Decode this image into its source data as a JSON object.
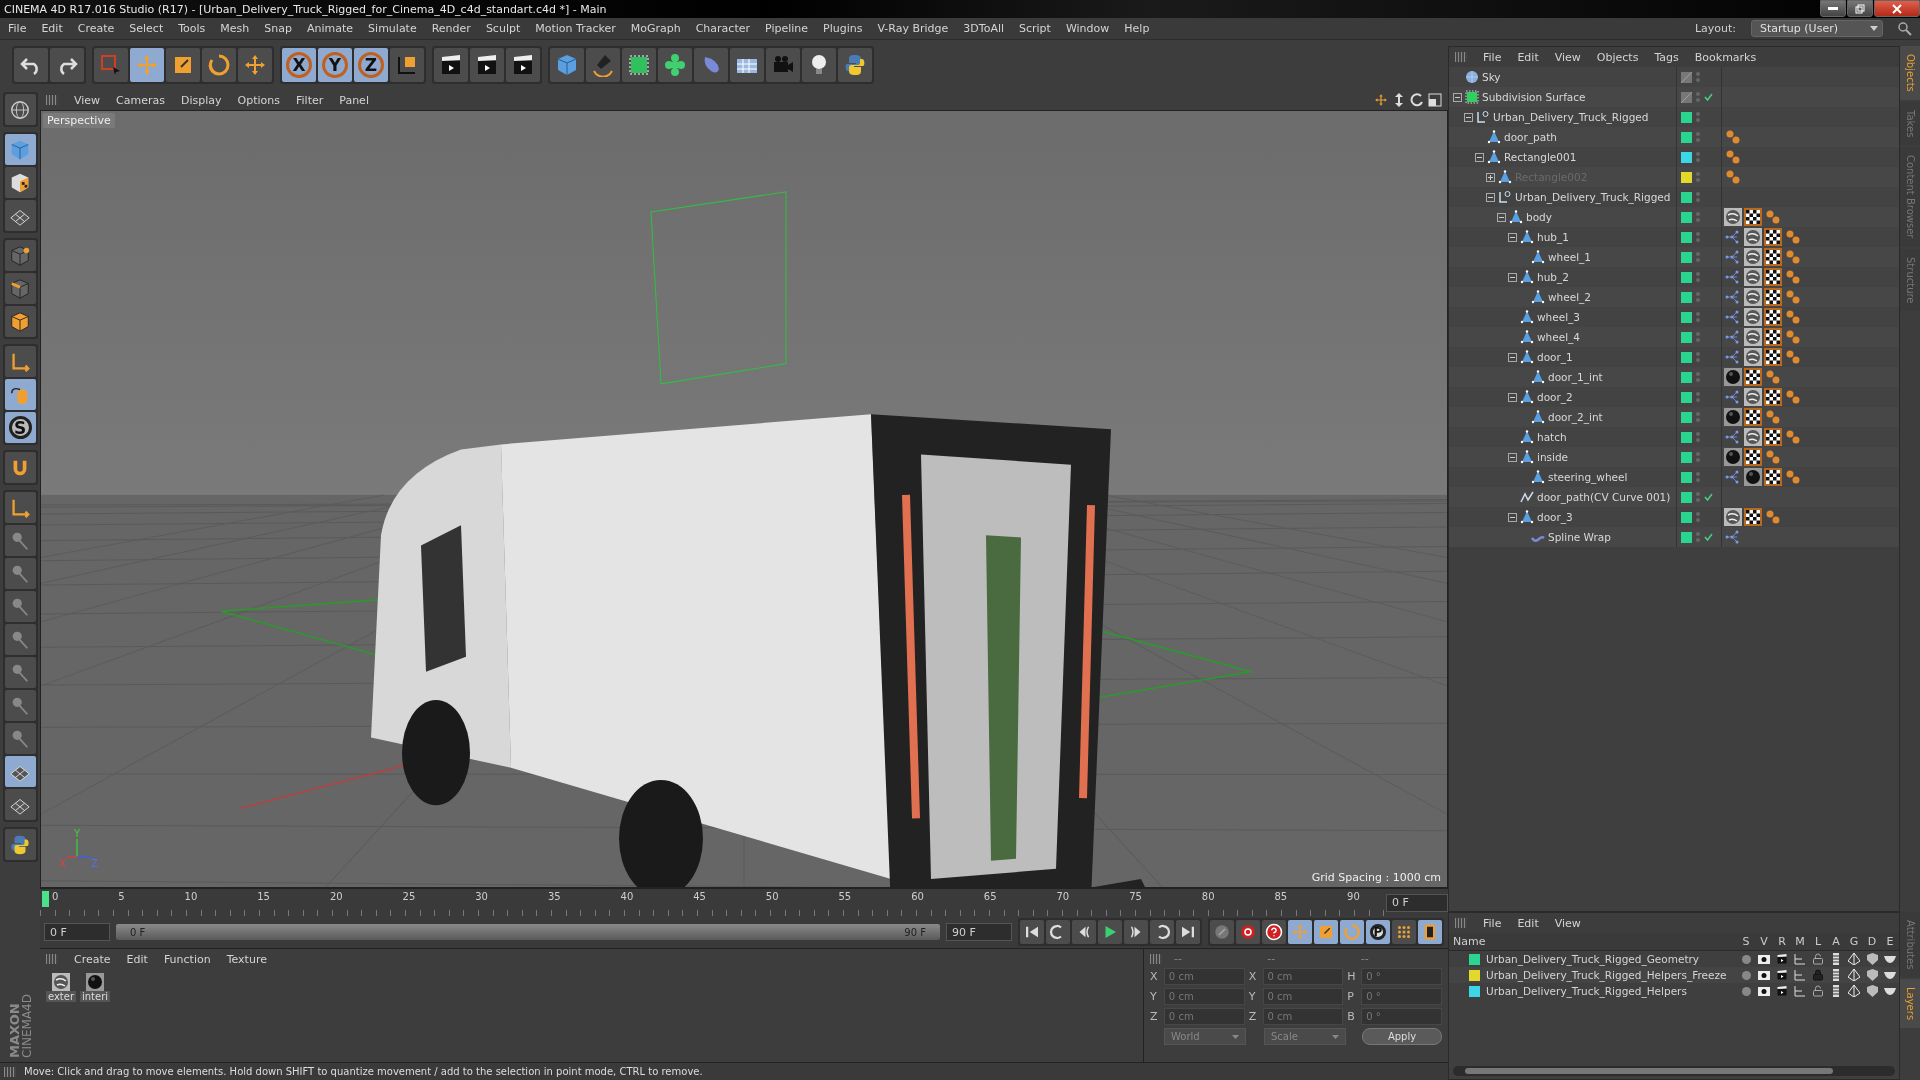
{
  "window": {
    "title": "CINEMA 4D R17.016 Studio (R17) - [Urban_Delivery_Truck_Rigged_for_Cinema_4D_c4d_standart.c4d *] - Main"
  },
  "menu": [
    "File",
    "Edit",
    "Create",
    "Select",
    "Tools",
    "Mesh",
    "Snap",
    "Animate",
    "Simulate",
    "Render",
    "Sculpt",
    "Motion Tracker",
    "MoGraph",
    "Character",
    "Pipeline",
    "Plugins",
    "V-Ray Bridge",
    "3DToAll",
    "Script",
    "Window",
    "Help"
  ],
  "layout": {
    "label": "Layout:",
    "value": "Startup (User)"
  },
  "toolbar": [
    [
      {
        "kind": "undo",
        "selected": false
      },
      {
        "kind": "redo",
        "selected": false
      }
    ],
    [
      {
        "kind": "select",
        "selected": false
      },
      {
        "kind": "move",
        "selected": true
      },
      {
        "kind": "scale",
        "selected": false
      },
      {
        "kind": "rotate",
        "selected": false
      },
      {
        "kind": "move",
        "selected": false
      }
    ],
    [
      {
        "kind": "axis",
        "label": "X",
        "selected": true
      },
      {
        "kind": "axis",
        "label": "Y",
        "selected": true
      },
      {
        "kind": "axis",
        "label": "Z",
        "selected": true
      },
      {
        "kind": "coordinates",
        "selected": false
      }
    ],
    [
      {
        "kind": "clapper",
        "selected": false
      },
      {
        "kind": "clapper",
        "selected": false
      },
      {
        "kind": "clapper",
        "selected": false
      }
    ],
    [
      {
        "kind": "cube",
        "selected": false
      },
      {
        "kind": "pen",
        "selected": false
      },
      {
        "kind": "subdivision",
        "selected": false
      },
      {
        "kind": "cloner",
        "selected": false
      },
      {
        "kind": "deformer",
        "selected": false
      },
      {
        "kind": "floor",
        "selected": false
      },
      {
        "kind": "camera",
        "selected": false
      },
      {
        "kind": "bulb",
        "selected": false
      },
      {
        "kind": "python",
        "selected": false
      }
    ]
  ],
  "left_tools": [
    [
      {
        "kind": "globe",
        "selected": false
      }
    ],
    [
      {
        "kind": "cube",
        "selected": true
      },
      {
        "kind": "checker-cube",
        "selected": false
      },
      {
        "kind": "grid",
        "selected": false
      }
    ],
    [
      {
        "kind": "cube-point",
        "selected": false
      },
      {
        "kind": "cube-edge",
        "selected": false
      },
      {
        "kind": "cube-face",
        "selected": false
      }
    ],
    [
      {
        "kind": "axis-corner",
        "selected": false
      },
      {
        "kind": "mouse",
        "selected": true
      },
      {
        "kind": "snap",
        "label": "S",
        "selected": true
      }
    ],
    [
      {
        "kind": "magnet",
        "selected": false
      }
    ],
    [
      {
        "kind": "axis-corner",
        "selected": false
      },
      {
        "kind": "pin",
        "selected": false
      },
      {
        "kind": "pin",
        "selected": false
      },
      {
        "kind": "pin",
        "selected": false
      },
      {
        "kind": "pin",
        "selected": false
      },
      {
        "kind": "pin",
        "selected": false
      },
      {
        "kind": "pin",
        "selected": false
      },
      {
        "kind": "pin",
        "selected": false
      },
      {
        "kind": "grid",
        "selected": true
      },
      {
        "kind": "grid",
        "selected": false
      }
    ],
    [
      {
        "kind": "python",
        "selected": false
      }
    ]
  ],
  "logo": [
    "MAXON",
    "CINEMA4D"
  ],
  "viewport": {
    "menu": [
      "View",
      "Cameras",
      "Display",
      "Options",
      "Filter",
      "Panel"
    ],
    "camera": "Perspective",
    "grid_spacing": "Grid Spacing : 1000 cm",
    "axes": [
      "Y",
      "X",
      "Z"
    ]
  },
  "timeline": {
    "ticks": [
      "0",
      "5",
      "10",
      "15",
      "20",
      "25",
      "30",
      "35",
      "40",
      "45",
      "50",
      "55",
      "60",
      "65",
      "70",
      "75",
      "80",
      "85",
      "90"
    ],
    "current": "0 F",
    "start": "0 F",
    "range_start": "0 F",
    "range_end": "90 F",
    "level": 1,
    "end": "90 F"
  },
  "playback": [
    {
      "kind": "first",
      "selected": false
    },
    {
      "kind": "loop-back",
      "selected": false
    },
    {
      "kind": "prev",
      "selected": false
    },
    {
      "kind": "play",
      "selected": false
    },
    {
      "kind": "next",
      "selected": false
    },
    {
      "kind": "loop",
      "selected": false
    },
    {
      "kind": "last",
      "selected": false
    }
  ],
  "keying": [
    {
      "kind": "key-off",
      "selected": false
    },
    {
      "kind": "record",
      "selected": false
    },
    {
      "kind": "help",
      "selected": false
    },
    {
      "kind": "move",
      "selected": true
    },
    {
      "kind": "scale",
      "selected": true
    },
    {
      "kind": "rotate",
      "selected": true
    },
    {
      "kind": "param",
      "label": "P",
      "selected": true
    },
    {
      "kind": "dots",
      "selected": false
    },
    {
      "kind": "film",
      "selected": true
    }
  ],
  "materials": {
    "menu": [
      "Create",
      "Edit",
      "Function",
      "Texture"
    ],
    "items": [
      {
        "name": "exter",
        "kind": "light"
      },
      {
        "name": "interi",
        "kind": "dark"
      }
    ]
  },
  "coordinates": {
    "headers": [
      "--",
      "--",
      "--"
    ],
    "rows": [
      {
        "labels": [
          "X",
          "X",
          "H"
        ],
        "values": [
          "0 cm",
          "0 cm",
          "0 °"
        ]
      },
      {
        "labels": [
          "Y",
          "Y",
          "P"
        ],
        "values": [
          "0 cm",
          "0 cm",
          "0 °"
        ]
      },
      {
        "labels": [
          "Z",
          "Z",
          "B"
        ],
        "values": [
          "0 cm",
          "0 cm",
          "0 °"
        ]
      }
    ],
    "mode": "World",
    "size_mode": "Scale",
    "apply": "Apply"
  },
  "status": "Move: Click and drag to move elements. Hold down SHIFT to quantize movement / add to the selection in point mode, CTRL to remove.",
  "objects": {
    "menu": [
      "File",
      "Edit",
      "View",
      "Objects",
      "Tags",
      "Bookmarks"
    ],
    "tree": [
      {
        "name": "Sky",
        "kind": "sky",
        "checked": false,
        "disabled": false
      },
      {
        "name": "Subdivision Surface",
        "kind": "subdivision",
        "checked": true,
        "disabled": false,
        "expanded": true,
        "children": [
          {
            "name": "Urban_Delivery_Truck_Rigged",
            "kind": "null",
            "color": "#2bd58f",
            "checked": false,
            "disabled": false,
            "expanded": true,
            "children": [
              {
                "name": "door_path",
                "kind": "poly",
                "color": "#2bd58f",
                "checked": false,
                "disabled": false,
                "tags": [
                  {
                    "kind": "keys"
                  }
                ]
              },
              {
                "name": "Rectangle001",
                "kind": "poly",
                "color": "#3dd6e6",
                "checked": false,
                "disabled": false,
                "expanded": true,
                "tags": [
                  {
                    "kind": "keys"
                  }
                ],
                "children": [
                  {
                    "name": "Rectangle002",
                    "kind": "poly",
                    "color": "#e3d82c",
                    "checked": false,
                    "disabled": true,
                    "expanded": false,
                    "tags": [
                      {
                        "kind": "keys"
                      }
                    ]
                  },
                  {
                    "name": "Urban_Delivery_Truck_Rigged",
                    "kind": "null",
                    "color": "#2bd58f",
                    "checked": false,
                    "disabled": false,
                    "expanded": true,
                    "children": [
                      {
                        "name": "body",
                        "kind": "poly",
                        "color": "#2bd58f",
                        "checked": false,
                        "disabled": false,
                        "expanded": true,
                        "tags": [
                          {
                            "kind": "tex"
                          },
                          {
                            "kind": "checker"
                          },
                          {
                            "kind": "keys"
                          }
                        ],
                        "children": [
                          {
                            "name": "hub_1",
                            "kind": "poly",
                            "color": "#2bd58f",
                            "checked": false,
                            "disabled": false,
                            "expanded": true,
                            "tags": [
                              {
                                "kind": "vmap"
                              },
                              {
                                "kind": "tex"
                              },
                              {
                                "kind": "checker"
                              },
                              {
                                "kind": "keys"
                              }
                            ],
                            "children": [
                              {
                                "name": "wheel_1",
                                "kind": "poly",
                                "color": "#2bd58f",
                                "checked": false,
                                "disabled": false,
                                "tags": [
                                  {
                                    "kind": "vmap"
                                  },
                                  {
                                    "kind": "tex"
                                  },
                                  {
                                    "kind": "checker"
                                  },
                                  {
                                    "kind": "keys"
                                  }
                                ]
                              }
                            ]
                          },
                          {
                            "name": "hub_2",
                            "kind": "poly",
                            "color": "#2bd58f",
                            "checked": false,
                            "disabled": false,
                            "expanded": true,
                            "tags": [
                              {
                                "kind": "vmap"
                              },
                              {
                                "kind": "tex"
                              },
                              {
                                "kind": "checker"
                              },
                              {
                                "kind": "keys"
                              }
                            ],
                            "children": [
                              {
                                "name": "wheel_2",
                                "kind": "poly",
                                "color": "#2bd58f",
                                "checked": false,
                                "disabled": false,
                                "tags": [
                                  {
                                    "kind": "vmap"
                                  },
                                  {
                                    "kind": "tex"
                                  },
                                  {
                                    "kind": "checker"
                                  },
                                  {
                                    "kind": "keys"
                                  }
                                ]
                              }
                            ]
                          },
                          {
                            "name": "wheel_3",
                            "kind": "poly",
                            "color": "#2bd58f",
                            "checked": false,
                            "disabled": false,
                            "tags": [
                              {
                                "kind": "vmap"
                              },
                              {
                                "kind": "tex"
                              },
                              {
                                "kind": "checker"
                              },
                              {
                                "kind": "keys"
                              }
                            ]
                          },
                          {
                            "name": "wheel_4",
                            "kind": "poly",
                            "color": "#2bd58f",
                            "checked": false,
                            "disabled": false,
                            "tags": [
                              {
                                "kind": "vmap"
                              },
                              {
                                "kind": "tex"
                              },
                              {
                                "kind": "checker"
                              },
                              {
                                "kind": "keys"
                              }
                            ]
                          },
                          {
                            "name": "door_1",
                            "kind": "poly",
                            "color": "#2bd58f",
                            "checked": false,
                            "disabled": false,
                            "expanded": true,
                            "tags": [
                              {
                                "kind": "vmap"
                              },
                              {
                                "kind": "tex"
                              },
                              {
                                "kind": "checker"
                              },
                              {
                                "kind": "keys"
                              }
                            ],
                            "children": [
                              {
                                "name": "door_1_int",
                                "kind": "poly",
                                "color": "#2bd58f",
                                "checked": false,
                                "disabled": false,
                                "tags": [
                                  {
                                    "kind": "dark"
                                  },
                                  {
                                    "kind": "checker"
                                  },
                                  {
                                    "kind": "keys"
                                  }
                                ]
                              }
                            ]
                          },
                          {
                            "name": "door_2",
                            "kind": "poly",
                            "color": "#2bd58f",
                            "checked": false,
                            "disabled": false,
                            "expanded": true,
                            "tags": [
                              {
                                "kind": "vmap"
                              },
                              {
                                "kind": "tex"
                              },
                              {
                                "kind": "checker"
                              },
                              {
                                "kind": "keys"
                              }
                            ],
                            "children": [
                              {
                                "name": "door_2_int",
                                "kind": "poly",
                                "color": "#2bd58f",
                                "checked": false,
                                "disabled": false,
                                "tags": [
                                  {
                                    "kind": "dark"
                                  },
                                  {
                                    "kind": "checker"
                                  },
                                  {
                                    "kind": "keys"
                                  }
                                ]
                              }
                            ]
                          },
                          {
                            "name": "hatch",
                            "kind": "poly",
                            "color": "#2bd58f",
                            "checked": false,
                            "disabled": false,
                            "tags": [
                              {
                                "kind": "vmap"
                              },
                              {
                                "kind": "tex"
                              },
                              {
                                "kind": "checker"
                              },
                              {
                                "kind": "keys"
                              }
                            ]
                          },
                          {
                            "name": "inside",
                            "kind": "poly",
                            "color": "#2bd58f",
                            "checked": false,
                            "disabled": false,
                            "expanded": true,
                            "tags": [
                              {
                                "kind": "dark"
                              },
                              {
                                "kind": "checker"
                              },
                              {
                                "kind": "keys"
                              }
                            ],
                            "children": [
                              {
                                "name": "steering_wheel",
                                "kind": "poly",
                                "color": "#2bd58f",
                                "checked": false,
                                "disabled": false,
                                "tags": [
                                  {
                                    "kind": "vmap"
                                  },
                                  {
                                    "kind": "dark"
                                  },
                                  {
                                    "kind": "checker"
                                  },
                                  {
                                    "kind": "keys"
                                  }
                                ]
                              }
                            ]
                          },
                          {
                            "name": "door_path(CV Curve 001)",
                            "kind": "curve",
                            "color": "#2bd58f",
                            "checked": true,
                            "disabled": false
                          },
                          {
                            "name": "door_3",
                            "kind": "poly",
                            "color": "#2bd58f",
                            "checked": false,
                            "disabled": false,
                            "expanded": true,
                            "tags": [
                              {
                                "kind": "tex"
                              },
                              {
                                "kind": "checker"
                              },
                              {
                                "kind": "keys"
                              }
                            ],
                            "children": [
                              {
                                "name": "Spline Wrap",
                                "kind": "wrap",
                                "color": "#2bd58f",
                                "checked": true,
                                "disabled": false,
                                "tags": [
                                  {
                                    "kind": "vmap"
                                  }
                                ]
                              }
                            ]
                          }
                        ]
                      }
                    ]
                  }
                ]
              }
            ]
          }
        ]
      }
    ]
  },
  "object_tabs": [
    {
      "label": "Objects",
      "selected": true
    },
    {
      "label": "Takes",
      "selected": false
    },
    {
      "label": "Content Browser",
      "selected": false
    },
    {
      "label": "Structure",
      "selected": false
    }
  ],
  "layers": {
    "menu": [
      "File",
      "Edit",
      "View"
    ],
    "columns": [
      "Name",
      "S",
      "V",
      "R",
      "M",
      "L",
      "A",
      "G",
      "D",
      "E"
    ],
    "rows": [
      {
        "name": "Urban_Delivery_Truck_Rigged_Geometry",
        "color": "#2bd58f",
        "locked": false
      },
      {
        "name": "Urban_Delivery_Truck_Rigged_Helpers_Freeze",
        "color": "#e3d82c",
        "locked": true
      },
      {
        "name": "Urban_Delivery_Truck_Rigged_Helpers",
        "color": "#3dd6e6",
        "locked": false
      }
    ]
  },
  "layer_tabs": [
    {
      "label": "Attributes",
      "selected": false
    },
    {
      "label": "Layers",
      "selected": true
    }
  ]
}
